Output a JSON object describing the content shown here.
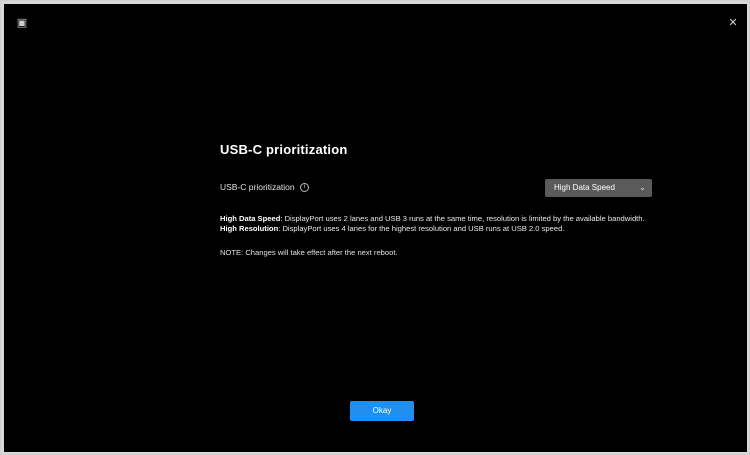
{
  "window": {
    "app_icon": "window-icon",
    "close_icon": "close-icon"
  },
  "dialog": {
    "title": "USB-C prioritization",
    "row_label": "USB-C prioritization",
    "dropdown_value": "High Data Speed",
    "desc_line1_bold": "High Data Speed",
    "desc_line1_rest": ": DisplayPort uses 2 lanes and USB 3 runs at the same time, resolution is limited by the available bandwidth.",
    "desc_line2_bold": "High Resolution",
    "desc_line2_rest": ": DisplayPort uses 4 lanes for the highest resolution and USB runs at USB 2.0 speed.",
    "note": "NOTE: Changes will take effect after the next reboot.",
    "ok_label": "Okay"
  },
  "colors": {
    "background": "#000000",
    "dropdown": "#5a5a5a",
    "accent": "#1f8ff0"
  }
}
